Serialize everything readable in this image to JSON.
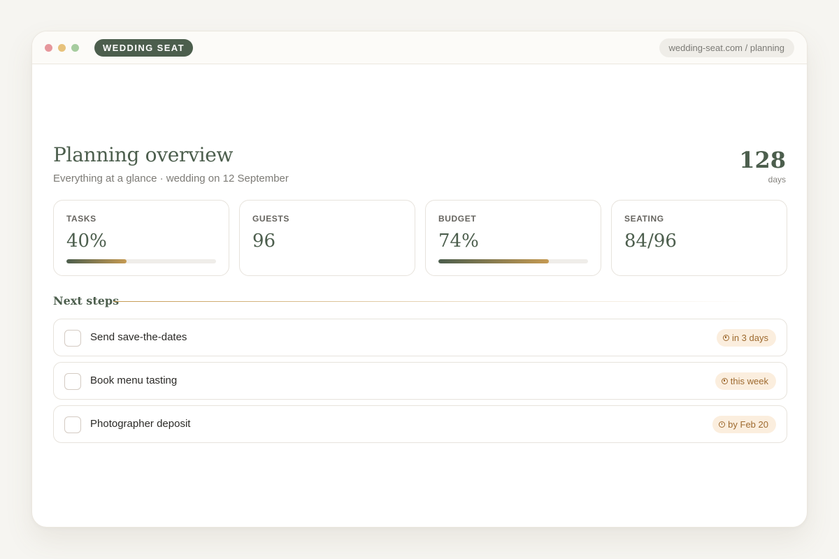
{
  "colors": {
    "brand": "#4c5e4d",
    "accent_gold": "#c59a52",
    "dot_red": "#e6979c",
    "dot_yellow": "#e7c27c",
    "dot_green": "#a6cc9f",
    "due_pill_bg": "#fbeede",
    "due_pill_text": "#9e6a2f"
  },
  "window": {
    "brand": "WEDDING SEAT",
    "url": "wedding-seat.com / planning"
  },
  "header": {
    "title": "Planning overview",
    "subtitle": "Everything at a glance · wedding on 12 September",
    "countdown_value": "128",
    "countdown_unit": "days"
  },
  "stats": [
    {
      "label": "TASKS",
      "value": "40%",
      "progress": 0.4
    },
    {
      "label": "GUESTS",
      "value": "96"
    },
    {
      "label": "BUDGET",
      "value": "74%",
      "progress": 0.74
    },
    {
      "label": "SEATING",
      "value": "84/96"
    }
  ],
  "next_steps": {
    "title": "Next steps",
    "items": [
      {
        "label": "Send save-the-dates",
        "due": "in 3 days",
        "icon": "clock-icon"
      },
      {
        "label": "Book menu tasting",
        "due": "this week",
        "icon": "clock-icon"
      },
      {
        "label": "Photographer deposit",
        "due": "by Feb 20",
        "icon": "clock-icon"
      }
    ]
  }
}
